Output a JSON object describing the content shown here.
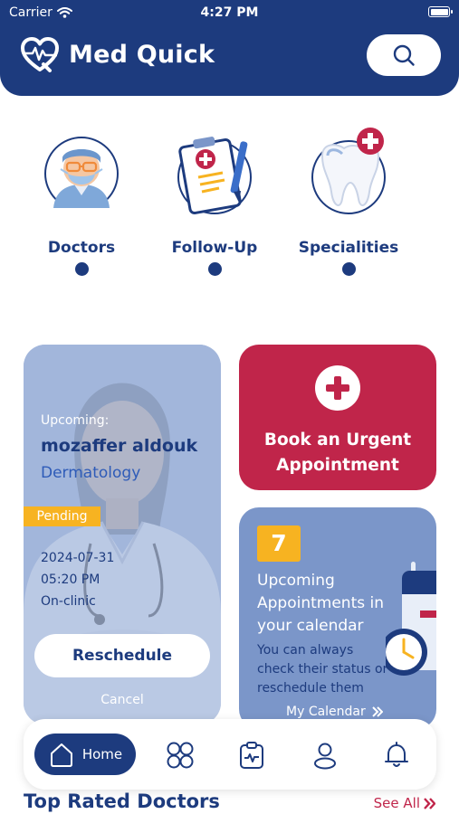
{
  "status_bar": {
    "carrier": "Carrier",
    "time": "4:27 PM"
  },
  "header": {
    "app_name": "Med Quick"
  },
  "categories": [
    {
      "label": "Doctors",
      "icon": "doctor-icon"
    },
    {
      "label": "Follow-Up",
      "icon": "clipboard-icon"
    },
    {
      "label": "Specialities",
      "icon": "tooth-icon"
    },
    {
      "label": "",
      "icon": "medicine-icon"
    }
  ],
  "appointment": {
    "upcoming_label": "Upcoming:",
    "doctor_name": "mozaffer aldouk",
    "speciality": "Dermatology",
    "status": "Pending",
    "date": "2024-07-31",
    "time": "05:20 PM",
    "location": "On-clinic",
    "reschedule_label": "Reschedule",
    "cancel_label": "Cancel"
  },
  "urgent": {
    "label": "Book an Urgent Appointment"
  },
  "calendar": {
    "count": "7",
    "title": "Upcoming Appointments in your calendar",
    "description": "You can always check their status or reschedule them",
    "link": "My Calendar"
  },
  "bottom_nav": {
    "home_label": "Home"
  },
  "top_rated": {
    "title": "Top Rated Doctors",
    "see_all": "See All"
  },
  "colors": {
    "primary": "#1d3b7e",
    "accent": "#c0254a",
    "highlight": "#f7b321",
    "card_blue": "#7b96c9"
  }
}
